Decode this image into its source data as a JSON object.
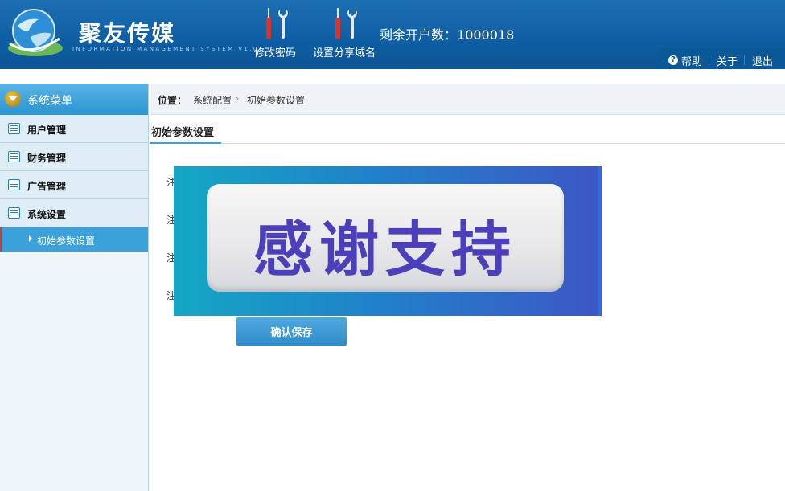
{
  "header": {
    "app_title": "聚友传媒",
    "app_subtitle": "INFORMATION MANAGEMENT SYSTEM V1.0",
    "tools": [
      {
        "label": "修改密码",
        "icon": "tools-icon"
      },
      {
        "label": "设置分享域名",
        "icon": "tools-icon"
      }
    ],
    "remaining_label": "剩余开户数：",
    "remaining_value": "1000018",
    "links": {
      "help": "帮助",
      "about": "关于",
      "logout": "退出"
    }
  },
  "sidebar": {
    "title": "系统菜单",
    "items": [
      {
        "label": "用户管理"
      },
      {
        "label": "财务管理"
      },
      {
        "label": "广告管理"
      },
      {
        "label": "系统设置"
      }
    ],
    "active_subitem": "初始参数设置"
  },
  "breadcrumb": {
    "position_label": "位置：",
    "items": [
      "系统配置",
      "初始参数设置"
    ]
  },
  "tab": {
    "label": "初始参数设置"
  },
  "form": {
    "labels": [
      "注",
      "注",
      "注",
      "注"
    ],
    "save_label": "确认保存"
  },
  "overlay": {
    "text": "感谢支持"
  },
  "colors": {
    "header_blue": "#0f5fa4",
    "accent_blue": "#3aa1da",
    "overlay_text": "#4b3fba"
  }
}
